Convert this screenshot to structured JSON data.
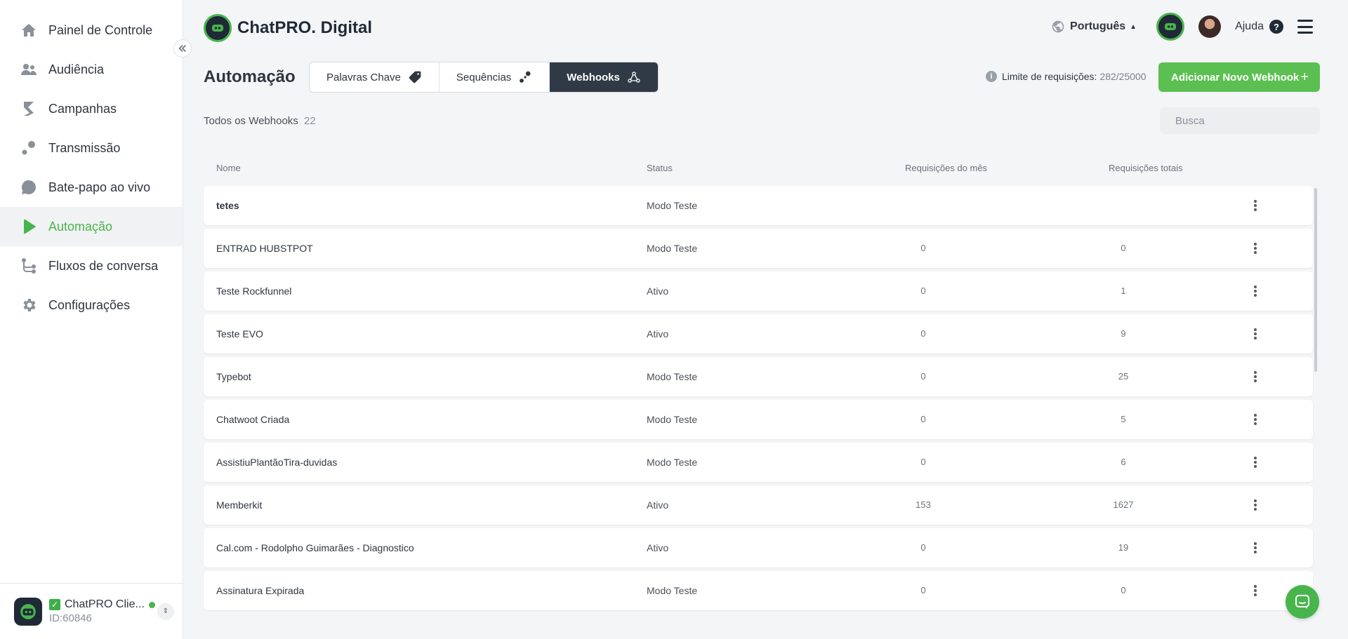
{
  "sidebar": {
    "items": [
      {
        "label": "Painel de Controle",
        "icon": "home-icon"
      },
      {
        "label": "Audiência",
        "icon": "users-icon"
      },
      {
        "label": "Campanhas",
        "icon": "campaign-icon"
      },
      {
        "label": "Transmissão",
        "icon": "broadcast-icon"
      },
      {
        "label": "Bate-papo ao vivo",
        "icon": "chat-icon"
      },
      {
        "label": "Automação",
        "icon": "play-icon"
      },
      {
        "label": "Fluxos de conversa",
        "icon": "flow-icon"
      },
      {
        "label": "Configurações",
        "icon": "gear-icon"
      }
    ],
    "active_index": 5,
    "account": {
      "name": "ChatPRO Clie...",
      "id": "ID:60846"
    }
  },
  "header": {
    "brand": "ChatPRO. Digital",
    "language": "Português",
    "help": "Ajuda"
  },
  "toolbar": {
    "title": "Automação",
    "tabs": [
      {
        "label": "Palavras Chave",
        "icon": "tag-icon"
      },
      {
        "label": "Sequências",
        "icon": "sequence-icon"
      },
      {
        "label": "Webhooks",
        "icon": "webhook-icon"
      }
    ],
    "active_tab": 2,
    "limit_label": "Limite de requisições:",
    "limit_value": "282/25000",
    "add_button": "Adicionar Novo Webhook"
  },
  "list": {
    "title": "Todos os Webhooks",
    "count": "22",
    "search_placeholder": "Busca",
    "columns": {
      "name": "Nome",
      "status": "Status",
      "month": "Requisições do mês",
      "total": "Requisições totais"
    },
    "rows": [
      {
        "name": "tetes",
        "status": "Modo Teste",
        "month": "",
        "total": ""
      },
      {
        "name": "ENTRAD HUBSTPOT",
        "status": "Modo Teste",
        "month": "0",
        "total": "0"
      },
      {
        "name": "Teste Rockfunnel",
        "status": "Ativo",
        "month": "0",
        "total": "1"
      },
      {
        "name": "Teste EVO",
        "status": "Ativo",
        "month": "0",
        "total": "9"
      },
      {
        "name": "Typebot",
        "status": "Modo Teste",
        "month": "0",
        "total": "25"
      },
      {
        "name": "Chatwoot Criada",
        "status": "Modo Teste",
        "month": "0",
        "total": "5"
      },
      {
        "name": "AssistiuPlantãoTira-duvidas",
        "status": "Modo Teste",
        "month": "0",
        "total": "6"
      },
      {
        "name": "Memberkit",
        "status": "Ativo",
        "month": "153",
        "total": "1627"
      },
      {
        "name": "Cal.com - Rodolpho Guimarães - Diagnostico",
        "status": "Ativo",
        "month": "0",
        "total": "19"
      },
      {
        "name": "Assinatura Expirada",
        "status": "Modo Teste",
        "month": "0",
        "total": "0"
      }
    ]
  },
  "colors": {
    "accent": "#48b54c",
    "dark": "#2f3a46",
    "button": "#5cbf52"
  }
}
